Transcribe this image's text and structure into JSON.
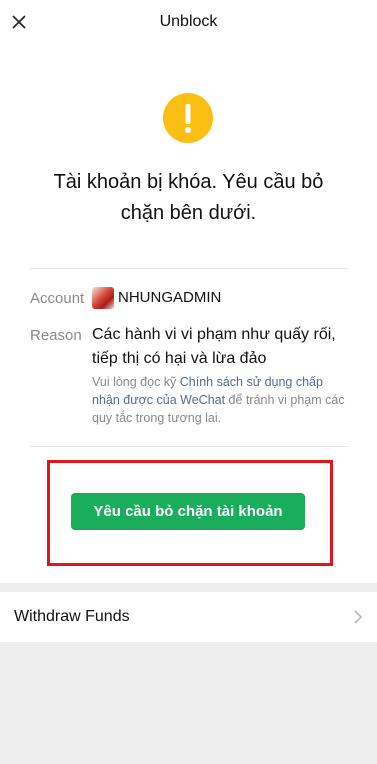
{
  "nav": {
    "title": "Unblock",
    "close_icon": "close-icon"
  },
  "alert": {
    "icon": "warning-icon",
    "icon_color": "#fbbf14",
    "headline": "Tài khoản bị khóa. Yêu cầu bỏ chặn bên dưới."
  },
  "details": {
    "account_label": "Account",
    "account_name": "NHUNGADMIN",
    "reason_label": "Reason",
    "reason_text": "Các hành vi vi phạm như quấy rối, tiếp thị có hại và lừa đảo",
    "note_prefix": "Vui lòng đọc kỹ ",
    "note_link": "Chính sách sử dụng chấp nhận được của WeChat",
    "note_suffix": " để tránh vi phạm các quy tắc trong tương lai."
  },
  "action": {
    "button_label": "Yêu cầu bỏ chặn tài khoản",
    "button_color": "#1aad5d",
    "highlight_color": "#e0161a"
  },
  "menu": {
    "withdraw_label": "Withdraw Funds",
    "chevron_icon": "chevron-right-icon"
  }
}
